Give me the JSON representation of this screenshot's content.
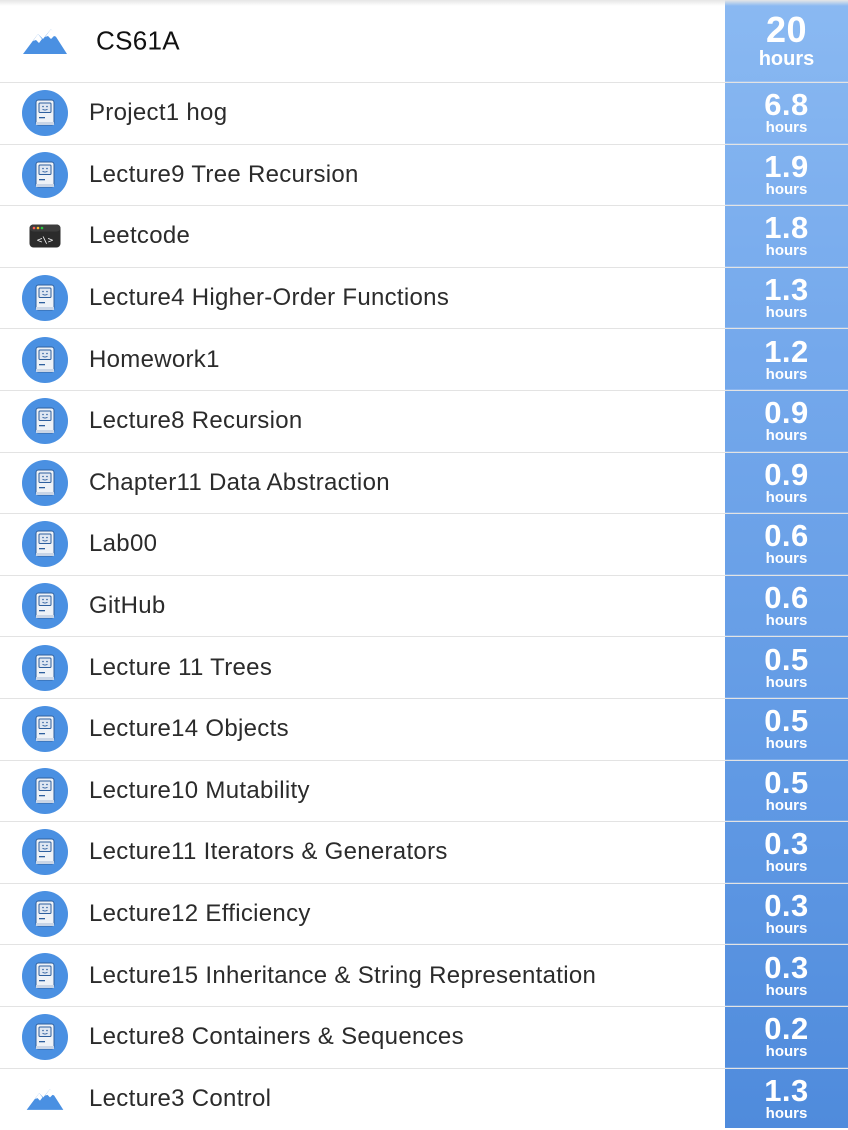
{
  "header": {
    "title": "CS61A",
    "icon": "mountain-icon",
    "time_value": "20",
    "time_unit": "hours"
  },
  "items": [
    {
      "label": "Project1 hog",
      "value": "6.8",
      "unit": "hours",
      "icon": "mac-computer-icon"
    },
    {
      "label": "Lecture9 Tree Recursion",
      "value": "1.9",
      "unit": "hours",
      "icon": "mac-computer-icon"
    },
    {
      "label": "Leetcode",
      "value": "1.8",
      "unit": "hours",
      "icon": "code-window-icon"
    },
    {
      "label": "Lecture4 Higher-Order Functions",
      "value": "1.3",
      "unit": "hours",
      "icon": "mac-computer-icon"
    },
    {
      "label": "Homework1",
      "value": "1.2",
      "unit": "hours",
      "icon": "mac-computer-icon"
    },
    {
      "label": "Lecture8 Recursion",
      "value": "0.9",
      "unit": "hours",
      "icon": "mac-computer-icon"
    },
    {
      "label": "Chapter11 Data Abstraction",
      "value": "0.9",
      "unit": "hours",
      "icon": "mac-computer-icon"
    },
    {
      "label": "Lab00",
      "value": "0.6",
      "unit": "hours",
      "icon": "mac-computer-icon"
    },
    {
      "label": "GitHub",
      "value": "0.6",
      "unit": "hours",
      "icon": "mac-computer-icon"
    },
    {
      "label": "Lecture 11 Trees",
      "value": "0.5",
      "unit": "hours",
      "icon": "mac-computer-icon"
    },
    {
      "label": "Lecture14 Objects",
      "value": "0.5",
      "unit": "hours",
      "icon": "mac-computer-icon"
    },
    {
      "label": "Lecture10 Mutability",
      "value": "0.5",
      "unit": "hours",
      "icon": "mac-computer-icon"
    },
    {
      "label": "Lecture11 Iterators & Generators",
      "value": "0.3",
      "unit": "hours",
      "icon": "mac-computer-icon"
    },
    {
      "label": "Lecture12 Efficiency",
      "value": "0.3",
      "unit": "hours",
      "icon": "mac-computer-icon"
    },
    {
      "label": "Lecture15 Inheritance & String Representation",
      "value": "0.3",
      "unit": "hours",
      "icon": "mac-computer-icon"
    },
    {
      "label": "Lecture8 Containers & Sequences",
      "value": "0.2",
      "unit": "hours",
      "icon": "mac-computer-icon"
    },
    {
      "label": "Lecture3 Control",
      "value": "1.3",
      "unit": "hours",
      "icon": "mountain-icon"
    }
  ],
  "colors": {
    "accent_top": "#8ab9f2",
    "accent_bottom": "#4f8bdc",
    "icon_blue": "#4a90e2"
  }
}
